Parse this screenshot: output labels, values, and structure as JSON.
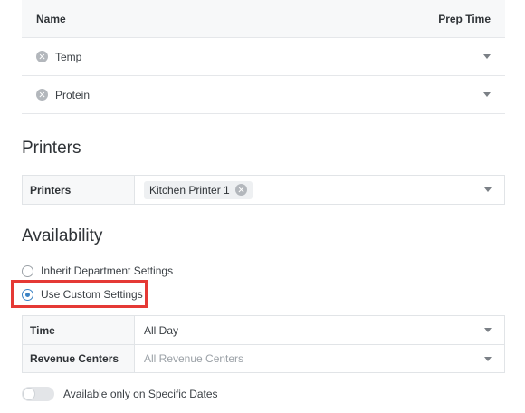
{
  "modifiers": {
    "headers": {
      "name": "Name",
      "prep_time": "Prep Time"
    },
    "rows": [
      {
        "label": "Temp"
      },
      {
        "label": "Protein"
      }
    ]
  },
  "printers": {
    "section_title": "Printers",
    "field_label": "Printers",
    "chip_label": "Kitchen Printer 1"
  },
  "availability": {
    "section_title": "Availability",
    "radio_inherit": "Inherit Department Settings",
    "radio_custom": "Use Custom Settings",
    "selected": "custom",
    "time_label": "Time",
    "time_value": "All Day",
    "revenue_label": "Revenue Centers",
    "revenue_placeholder": "All Revenue Centers",
    "toggle_label": "Available only on Specific Dates",
    "toggle_on": false
  },
  "colors": {
    "accent": "#3b82c4",
    "highlight": "#e53935"
  }
}
